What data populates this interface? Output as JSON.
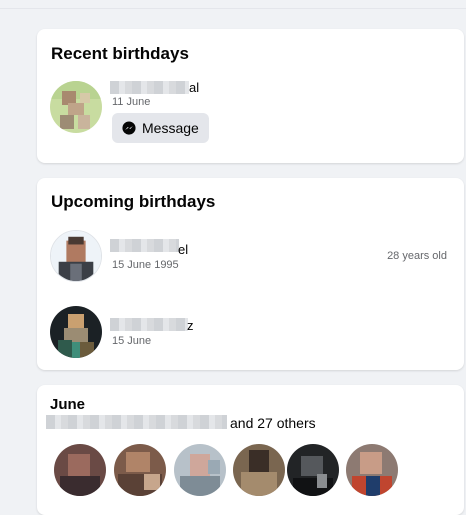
{
  "recent": {
    "title": "Recent birthdays",
    "person": {
      "name_tail": "al",
      "date": "11 June",
      "button_label": "Message"
    }
  },
  "upcoming": {
    "title": "Upcoming birthdays",
    "people": [
      {
        "name_tail": "el",
        "date": "15 June 1995",
        "age": "28 years old"
      },
      {
        "name_tail": "z",
        "date": "15 June"
      }
    ]
  },
  "june": {
    "title": "June",
    "others": "and 27 others"
  },
  "colors": {
    "card": "#ffffff",
    "page_bg": "#f0f2f5",
    "secondary_text": "#65676b",
    "button_bg": "#e4e6eb"
  }
}
